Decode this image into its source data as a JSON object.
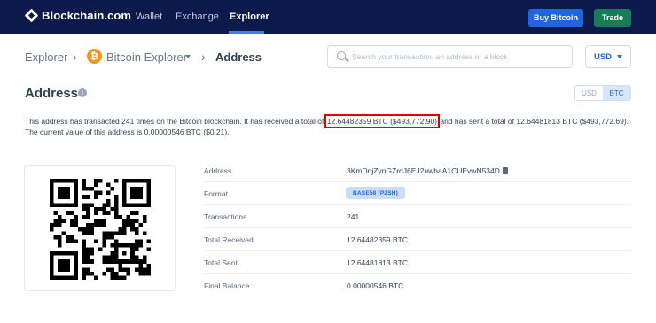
{
  "nav": {
    "brand": "Blockchain.com",
    "links": [
      "Wallet",
      "Exchange",
      "Explorer"
    ],
    "buy_label": "Buy Bitcoin",
    "trade_label": "Trade"
  },
  "breadcrumb": {
    "root": "Explorer",
    "coin_symbol": "₿",
    "coin_explorer": "Bitcoin Explorer",
    "current": "Address"
  },
  "search": {
    "placeholder": "Search your transaction, an address or a block"
  },
  "currency": {
    "selected": "USD"
  },
  "page": {
    "title": "Address",
    "toggle": [
      "USD",
      "BTC"
    ],
    "toggle_active": "BTC"
  },
  "summary": {
    "part1": "This address has transacted 241 times on the Bitcoin blockchain. It has received a total of ",
    "highlight": "12.64482359 BTC ($493,772.90)",
    "part2": " and has sent a total of 12.64481813 BTC ($493,772.69). The current value of this address is 0.00000546 BTC ($0.21)."
  },
  "details": {
    "address_label": "Address",
    "address_value": "3KmDnjZynGZrdJ6EJ2uwhaA1CUEvwN534D",
    "format_label": "Format",
    "format_value": "BASE58 (P2SH)",
    "transactions_label": "Transactions",
    "transactions_value": "241",
    "received_label": "Total Received",
    "received_value": "12.64482359 BTC",
    "sent_label": "Total Sent",
    "sent_value": "12.64481813 BTC",
    "balance_label": "Final Balance",
    "balance_value": "0.00000546 BTC"
  },
  "colors": {
    "nav_bg": "#0c1a4b",
    "accent": "#1d66db",
    "trade": "#167d56",
    "bitcoin": "#f7931a",
    "highlight_border": "#e00000"
  },
  "icons": [
    "logo-icon",
    "bitcoin-icon",
    "chevron-down-icon",
    "search-icon",
    "info-icon",
    "copy-icon",
    "qr-code"
  ]
}
